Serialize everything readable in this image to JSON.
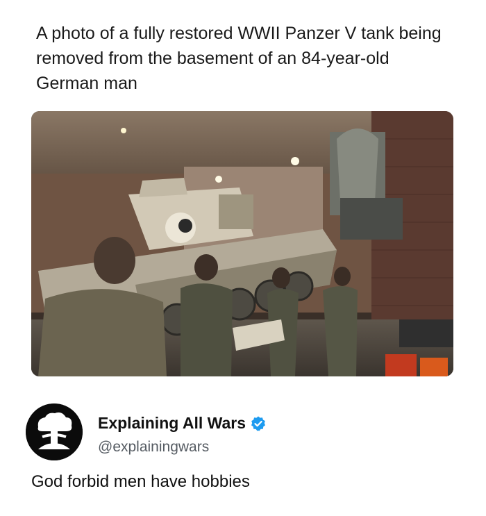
{
  "quote": {
    "text": "A photo of a fully restored WWII Panzer V tank being removed from the basement of an 84-year-old German man"
  },
  "photo": {
    "subject": "tank-in-basement-photo"
  },
  "post": {
    "display_name": "Explaining All Wars",
    "handle": "@explainingwars",
    "text": "God forbid men have hobbies",
    "verified": true,
    "verified_color": "#1d9bf0"
  },
  "colors": {
    "background": "#ffffff",
    "text": "#111111",
    "handle": "#555b62"
  }
}
